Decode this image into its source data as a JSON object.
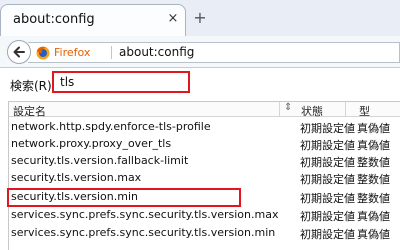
{
  "tab": {
    "title": "about:config",
    "close_glyph": "×",
    "newtab_glyph": "+"
  },
  "navbar": {
    "identity_label": "Firefox",
    "url": "about:config"
  },
  "search": {
    "label": "検索(R):",
    "value": "tls"
  },
  "table": {
    "headers": {
      "name": "設定名",
      "status": "状態",
      "type": "型"
    },
    "rows": [
      {
        "name": "network.http.spdy.enforce-tls-profile",
        "status": "初期設定値",
        "type": "真偽値"
      },
      {
        "name": "network.proxy.proxy_over_tls",
        "status": "初期設定値",
        "type": "真偽値"
      },
      {
        "name": "security.tls.version.fallback-limit",
        "status": "初期設定値",
        "type": "整数値"
      },
      {
        "name": "security.tls.version.max",
        "status": "初期設定値",
        "type": "整数値"
      },
      {
        "name": "security.tls.version.min",
        "status": "初期設定値",
        "type": "整数値"
      },
      {
        "name": "services.sync.prefs.sync.security.tls.version.max",
        "status": "初期設定値",
        "type": "真偽値"
      },
      {
        "name": "services.sync.prefs.sync.security.tls.version.min",
        "status": "初期設定値",
        "type": "真偽値"
      }
    ]
  },
  "colors": {
    "highlight": "#e0171e",
    "firefox_orange": "#e66000"
  },
  "icons": {
    "back": "back-arrow-icon",
    "identity": "firefox-logo-icon",
    "sort": "sort-icon"
  }
}
